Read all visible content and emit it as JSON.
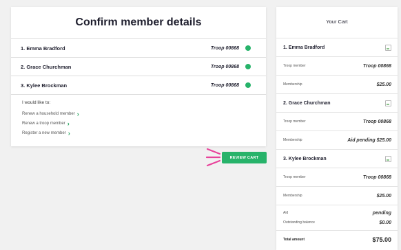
{
  "header": {
    "title": "Confirm member details"
  },
  "members": [
    {
      "name": "1. Emma Bradford",
      "troop": "Troop 00868"
    },
    {
      "name": "2. Grace Churchman",
      "troop": "Troop 00868"
    },
    {
      "name": "3. Kylee Brockman",
      "troop": "Troop 00868"
    }
  ],
  "options": {
    "heading": "I would like to:",
    "links": [
      {
        "label": "Renew a household member"
      },
      {
        "label": "Renew a troop member"
      },
      {
        "label": "Register a new member"
      }
    ]
  },
  "review_cart": {
    "label": "REVIEW CART"
  },
  "colors": {
    "accent": "#27b36a",
    "annotation": "#e8439b"
  },
  "icons": {
    "chevron": "chevron-right-icon",
    "status": "status-dot-icon",
    "image": "broken-image-icon"
  },
  "cart": {
    "title": "Your Cart",
    "members": [
      {
        "name": "1. Emma Bradford",
        "troop_label": "Troop member",
        "troop_value": "Troop 00868",
        "membership_label": "Membership",
        "membership_value": "$25.00"
      },
      {
        "name": "2. Grace Churchman",
        "troop_label": "Troop member",
        "troop_value": "Troop 00868",
        "membership_label": "Membership",
        "membership_value": "Aid pending $25.00"
      },
      {
        "name": "3. Kylee Brockman",
        "troop_label": "Troop member",
        "troop_value": "Troop 00868",
        "membership_label": "Membership",
        "membership_value": "$25.00"
      }
    ],
    "aid_label": "Aid",
    "aid_value": "pending",
    "outstanding_label": "Outstanding balance",
    "outstanding_value": "$0.00",
    "total_label": "Total amount",
    "total_value": "$75.00"
  }
}
